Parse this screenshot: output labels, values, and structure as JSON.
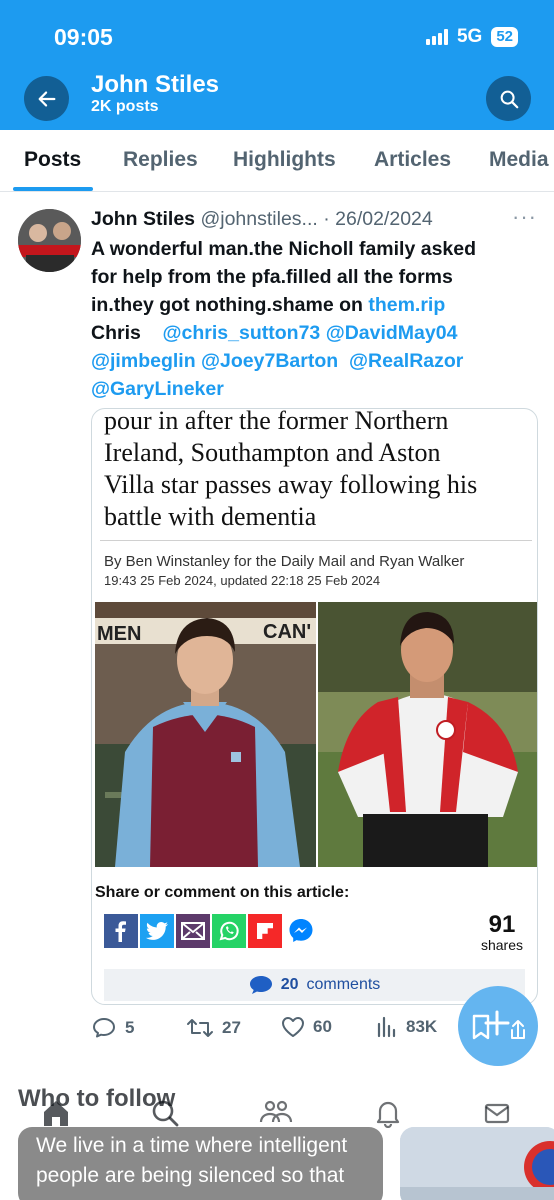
{
  "status": {
    "time": "09:05",
    "network": "5G",
    "battery": "52"
  },
  "header": {
    "name": "John Stiles",
    "posts": "2K posts"
  },
  "tabs": [
    "Posts",
    "Replies",
    "Highlights",
    "Articles",
    "Media"
  ],
  "tweet": {
    "name": "John Stiles",
    "handle": "@johnstiles...",
    "date": "· 26/02/2024",
    "more": "···",
    "text_line1": "A wonderful man.the Nicholl family asked",
    "text_line2": "for help from the pfa.filled all the forms",
    "text_line3": "in.they got nothing.shame on ",
    "link_rip": "them.rip",
    "chris": "Chris",
    "mention_sutton": "@chris_sutton73",
    "mention_may": "@DavidMay04",
    "mention_beglin": "@jimbeglin",
    "mention_barton": "@Joey7Barton",
    "mention_razor": "@RealRazor",
    "mention_lineker": "@GaryLineker"
  },
  "article": {
    "headline_line1": "pour in after the former Northern",
    "headline_line2": "Ireland, Southampton and Aston",
    "headline_line3": "Villa star passes away following his",
    "headline_line4": "battle with dementia",
    "byline": "By Ben Winstanley for the Daily Mail and Ryan Walker",
    "dateline": "19:43 25 Feb 2024, updated 22:18 25 Feb 2024",
    "photo1_sign_left": "MEN",
    "photo1_sign_right": "CAN'",
    "share_title": "Share or comment on this article:",
    "shares_count": "91",
    "shares_label": "shares",
    "comments_count": "20",
    "comments_label": "comments"
  },
  "actions": {
    "replies": "5",
    "reposts": "27",
    "likes": "60",
    "views": "83K"
  },
  "who_to_follow": "Who to follow",
  "promo": {
    "line1": "We live in a time where intelligent",
    "line2": "people are being silenced so that"
  },
  "colors": {
    "brand": "#1d9bf0",
    "header_button": "#125f95",
    "fab": "#64b5f0"
  }
}
